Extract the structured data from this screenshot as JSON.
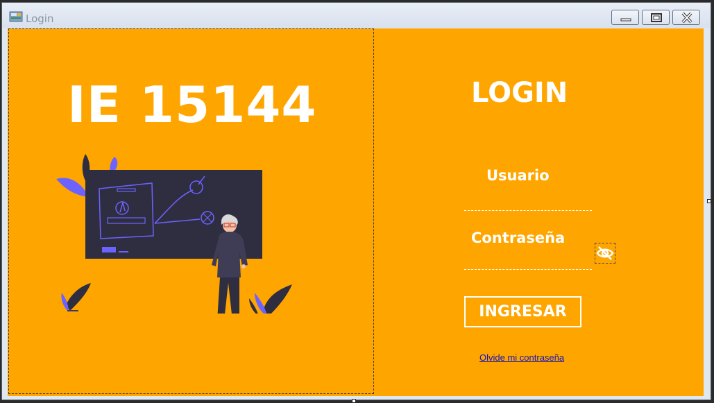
{
  "window": {
    "title": "Login",
    "minimize_icon": "minimize-icon",
    "maximize_icon": "maximize-icon",
    "close_icon": "close-icon",
    "app_icon": "app-icon"
  },
  "left_panel": {
    "brand_text": "IE 15144",
    "illustration": "teacher-at-blackboard-illustration"
  },
  "login": {
    "title": "LOGIN",
    "username_label": "Usuario",
    "username_value": "",
    "password_label": "Contraseña",
    "password_value": "",
    "toggle_password_icon": "eye-off-icon",
    "submit_label": "INGRESAR",
    "forgot_link": "Olvide mi contraseña"
  },
  "colors": {
    "background": "#ffa500",
    "text": "#ffffff",
    "link": "#1414b8",
    "board": "#2f2e41",
    "accent": "#6c63ff"
  }
}
